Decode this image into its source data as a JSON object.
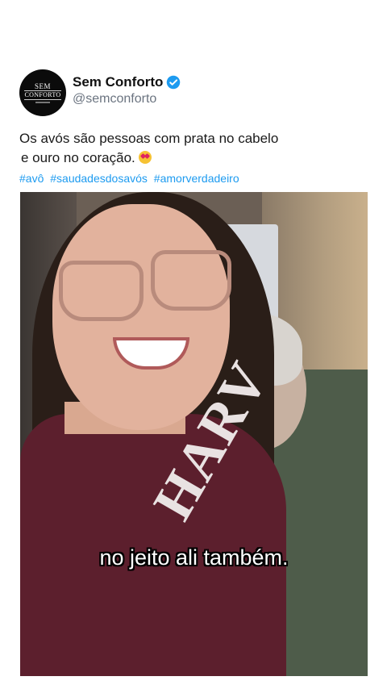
{
  "post": {
    "avatar": {
      "line1": "SEM",
      "line2": "CONFORTO"
    },
    "display_name": "Sem Conforto",
    "handle": "@semconforto",
    "verified_color": "#1d9bf0",
    "text_line1": "Os avós são pessoas com prata no cabelo",
    "text_line2": "e ouro no coração.",
    "emoji": "smiling-face-with-heart-eyes",
    "hashtags": [
      "#avô",
      "#saudadesdosavós",
      "#amorverdadeiro"
    ],
    "hashtag_color": "#1d9bf0"
  },
  "video": {
    "caption": "no jeito ali também.",
    "shirt_text": "HARV"
  }
}
